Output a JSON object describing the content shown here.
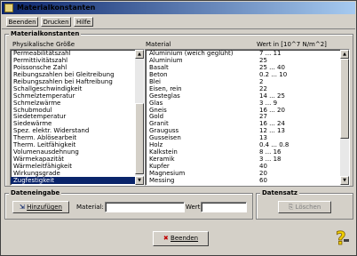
{
  "window": {
    "title": "Materialkonstanten"
  },
  "menu": {
    "beenden": "Beenden",
    "drucken": "Drucken",
    "hilfe": "Hilfe"
  },
  "group_main": {
    "title": "Materialkonstanten"
  },
  "properties": {
    "header": "Physikalische Größe",
    "items": [
      "Permeabilitätszahl",
      "Permittivitätszahl",
      "Poissonsche Zahl",
      "Reibungszahlen bei Gleitreibung",
      "Reibungszahlen bei Haftreibung",
      "Schallgeschwindigkeit",
      "Schmelztemperatur",
      "Schmelzwärme",
      "Schubmodul",
      "Siedetemperatur",
      "Siedewärme",
      "Spez. elektr. Widerstand",
      "Therm. Ablösearbeit",
      "Therm. Leitfähigkeit",
      "Volumenausdehnung",
      "Wärmekapazität",
      "Wärmeleitfähigkeit",
      "Wirkungsgrade",
      "Zugfestigkeit"
    ],
    "selected": "Zugfestigkeit"
  },
  "materials": {
    "header_material": "Material",
    "header_value": "Wert in [10^7 N/m^2]",
    "rows": [
      {
        "m": "Aluminium (weich geglüht)",
        "v": "7 ... 11"
      },
      {
        "m": "Aluminium",
        "v": "25"
      },
      {
        "m": "Basalt",
        "v": "25 ... 40"
      },
      {
        "m": "Beton",
        "v": "0.2 ... 10"
      },
      {
        "m": "Blei",
        "v": "2"
      },
      {
        "m": "Eisen, rein",
        "v": "22"
      },
      {
        "m": "Gesteglas",
        "v": "14 ... 25"
      },
      {
        "m": "Glas",
        "v": "3 ... 9"
      },
      {
        "m": "Gneis",
        "v": "16 ... 20"
      },
      {
        "m": "Gold",
        "v": "27"
      },
      {
        "m": "Granit",
        "v": "16 ... 24"
      },
      {
        "m": "Grauguss",
        "v": "12 ... 13"
      },
      {
        "m": "Gusseisen",
        "v": "13"
      },
      {
        "m": "Holz",
        "v": "0.4 ... 0.8"
      },
      {
        "m": "Kalkstein",
        "v": "8 ... 16"
      },
      {
        "m": "Keramik",
        "v": "3 ... 18"
      },
      {
        "m": "Kupfer",
        "v": "40"
      },
      {
        "m": "Magnesium",
        "v": "20"
      },
      {
        "m": "Messing",
        "v": "60"
      }
    ]
  },
  "dateneingabe": {
    "title": "Dateneingabe",
    "add_button": "Hinzufügen",
    "material_label": "Material:",
    "material_value": "",
    "wert_label": "Wert:",
    "wert_value": ""
  },
  "datensatz": {
    "title": "Datensatz",
    "delete_button": "Löschen"
  },
  "footer": {
    "beenden_button": "Beenden"
  }
}
